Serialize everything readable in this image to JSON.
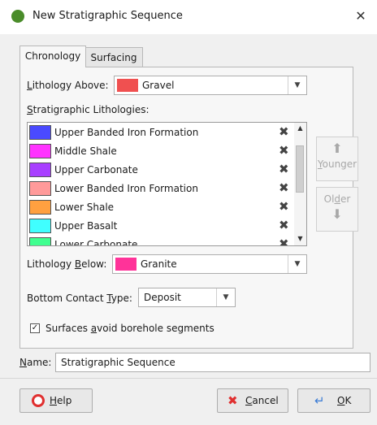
{
  "window": {
    "title": "New Stratigraphic Sequence",
    "close_glyph": "✕"
  },
  "tabs": [
    {
      "label": "Chronology",
      "active": true
    },
    {
      "label": "Surfacing",
      "active": false
    }
  ],
  "lithology_above": {
    "prefix": "",
    "underline": "L",
    "suffix": "ithology Above:",
    "value": "Gravel",
    "color": "#f05050"
  },
  "strat_list": {
    "heading_u": "S",
    "heading_rest": "tratigraphic Lithologies:",
    "items": [
      {
        "name": "Upper Banded Iron Formation",
        "color": "#4a4aff"
      },
      {
        "name": "Middle Shale",
        "color": "#ff33ff"
      },
      {
        "name": "Upper Carbonate",
        "color": "#a83fff"
      },
      {
        "name": "Lower Banded Iron Formation",
        "color": "#ff9a9a"
      },
      {
        "name": "Lower Shale",
        "color": "#ffa040"
      },
      {
        "name": "Upper Basalt",
        "color": "#40ffff"
      },
      {
        "name": "Lower Carbonate",
        "color": "#40ff90"
      }
    ],
    "delete_glyph": "✖"
  },
  "side_buttons": {
    "younger": {
      "u": "Y",
      "rest": "ounger",
      "arrow": "⬆"
    },
    "older": {
      "pre": "Ol",
      "u": "d",
      "post": "er",
      "arrow": "⬇"
    }
  },
  "lithology_below": {
    "prefix": "Lithology ",
    "underline": "B",
    "suffix": "elow:",
    "value": "Granite",
    "color": "#ff3399"
  },
  "bottom_contact": {
    "prefix": "Bottom Contact ",
    "underline": "T",
    "suffix": "ype:",
    "value": "Deposit"
  },
  "surfaces_avoid": {
    "checked": true,
    "prefix": "Surfaces ",
    "underline": "a",
    "suffix": "void borehole segments"
  },
  "name_field": {
    "underline": "N",
    "suffix": "ame:",
    "value": "Stratigraphic Sequence"
  },
  "buttons": {
    "help": {
      "u": "H",
      "rest": "elp"
    },
    "cancel": {
      "u": "C",
      "rest": "ancel"
    },
    "ok": {
      "u": "O",
      "rest": "K"
    }
  }
}
